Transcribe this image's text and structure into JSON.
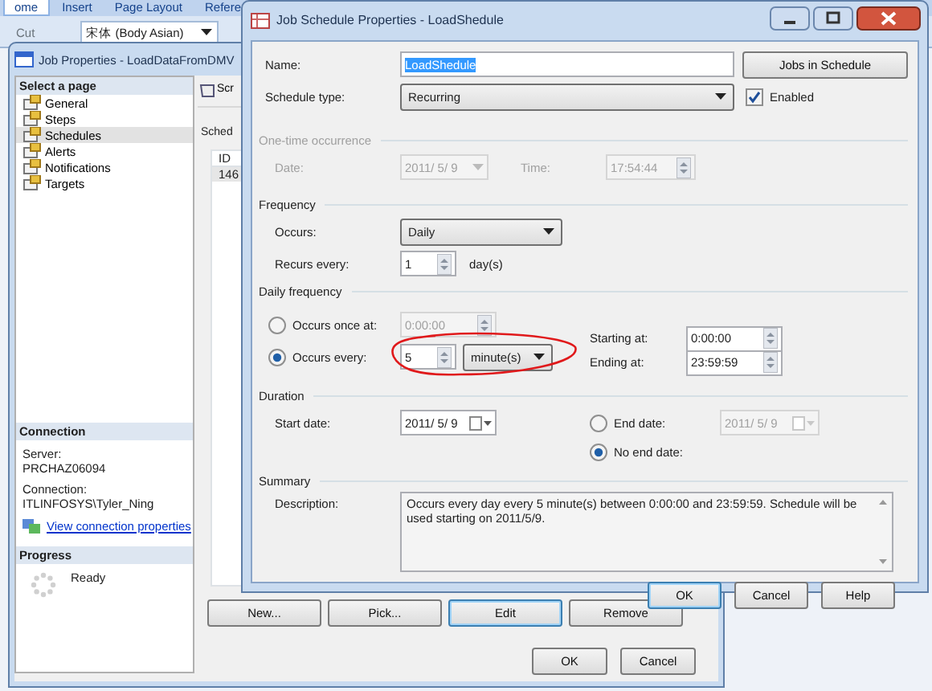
{
  "background_app": {
    "tabs": [
      {
        "label": "ome",
        "selected": true
      },
      {
        "label": "Insert",
        "selected": false
      },
      {
        "label": "Page Layout",
        "selected": false
      },
      {
        "label": "Refere",
        "selected": false
      }
    ],
    "cut": "Cut",
    "font": "宋体 (Body Asian)"
  },
  "job_window": {
    "title": "Job Properties - LoadDataFromDMV",
    "pages_header": "Select a page",
    "pages": [
      {
        "label": "General",
        "selected": false
      },
      {
        "label": "Steps",
        "selected": false
      },
      {
        "label": "Schedules",
        "selected": true
      },
      {
        "label": "Alerts",
        "selected": false
      },
      {
        "label": "Notifications",
        "selected": false
      },
      {
        "label": "Targets",
        "selected": false
      }
    ],
    "connection": {
      "header": "Connection",
      "server_label": "Server:",
      "server": "PRCHAZ06094",
      "connection_label": "Connection:",
      "connection": "ITLINFOSYS\\Tyler_Ning",
      "link": "View connection properties"
    },
    "progress": {
      "header": "Progress",
      "status": "Ready"
    },
    "toolbar_button": "Scr",
    "schedules_label": "Sched",
    "table": {
      "columns": [
        "ID"
      ],
      "rows": [
        [
          "146"
        ]
      ]
    },
    "buttons": [
      {
        "label": "New...",
        "default": false
      },
      {
        "label": "Pick...",
        "default": false
      },
      {
        "label": "Edit",
        "default": true
      },
      {
        "label": "Remove",
        "default": false
      }
    ],
    "footer_buttons": [
      {
        "label": "OK",
        "default": false
      },
      {
        "label": "Cancel",
        "default": false
      }
    ]
  },
  "schedule_dialog": {
    "title": "Job Schedule Properties - LoadShedule",
    "name": {
      "label": "Name:",
      "value": "LoadShedule",
      "selected": true
    },
    "jobs_button": "Jobs in Schedule",
    "schedule_type": {
      "label": "Schedule type:",
      "value": "Recurring"
    },
    "enabled": {
      "label": "Enabled",
      "checked": true
    },
    "one_time": {
      "legend": "One-time occurrence",
      "disabled": true,
      "date_label": "Date:",
      "date": "2011/ 5/ 9",
      "time_label": "Time:",
      "time": "17:54:44"
    },
    "frequency": {
      "legend": "Frequency",
      "occurs_label": "Occurs:",
      "occurs": "Daily",
      "recurs_label": "Recurs every:",
      "recurs": "1",
      "recurs_unit": "day(s)"
    },
    "daily_frequency": {
      "legend": "Daily frequency",
      "options": [
        {
          "kind": "once",
          "label": "Occurs once at:",
          "selected": false,
          "time": "0:00:00"
        },
        {
          "kind": "every",
          "label": "Occurs every:",
          "selected": true,
          "interval": "5",
          "unit": "minute(s)",
          "marked": true
        }
      ],
      "starting_label": "Starting at:",
      "starting": "0:00:00",
      "ending_label": "Ending at:",
      "ending": "23:59:59"
    },
    "duration": {
      "legend": "Duration",
      "start_label": "Start date:",
      "start": "2011/ 5/ 9",
      "end_options": [
        {
          "kind": "end_date",
          "label": "End date:",
          "selected": false,
          "date": "2011/ 5/ 9"
        },
        {
          "kind": "no_end",
          "label": "No end date:",
          "selected": true
        }
      ]
    },
    "summary": {
      "legend": "Summary",
      "description_label": "Description:",
      "description": "Occurs every day every 5 minute(s) between 0:00:00 and 23:59:59. Schedule will be used starting on 2011/5/9."
    },
    "buttons": [
      {
        "label": "OK",
        "default": true
      },
      {
        "label": "Cancel",
        "default": false
      },
      {
        "label": "Help",
        "default": false
      }
    ]
  }
}
